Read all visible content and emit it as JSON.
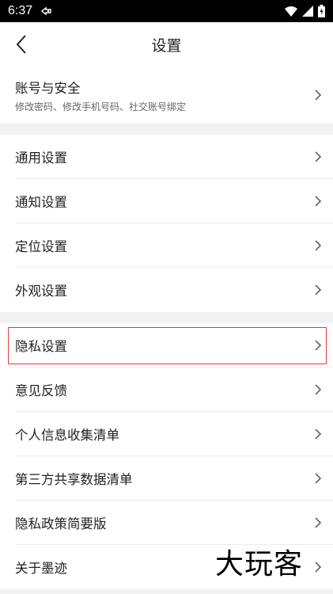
{
  "status_bar": {
    "time": "6:37",
    "notification_icon": "sync-icon",
    "wifi_icon": "wifi-icon",
    "signal_icon": "signal-icon",
    "battery_icon": "battery-charging-icon"
  },
  "header": {
    "title": "设置",
    "back_icon": "chevron-left-icon"
  },
  "account": {
    "label": "账号与安全",
    "subtitle": "修改密码、修改手机号码、社交账号绑定"
  },
  "general_section": [
    {
      "label": "通用设置"
    },
    {
      "label": "通知设置"
    },
    {
      "label": "定位设置"
    },
    {
      "label": "外观设置"
    }
  ],
  "other_section": [
    {
      "label": "隐私设置"
    },
    {
      "label": "意见反馈"
    },
    {
      "label": "个人信息收集清单"
    },
    {
      "label": "第三方共享数据清单"
    },
    {
      "label": "隐私政策简要版"
    },
    {
      "label": "关于墨迹"
    }
  ],
  "highlight_color": "#e03a3a",
  "watermark": "大玩客"
}
